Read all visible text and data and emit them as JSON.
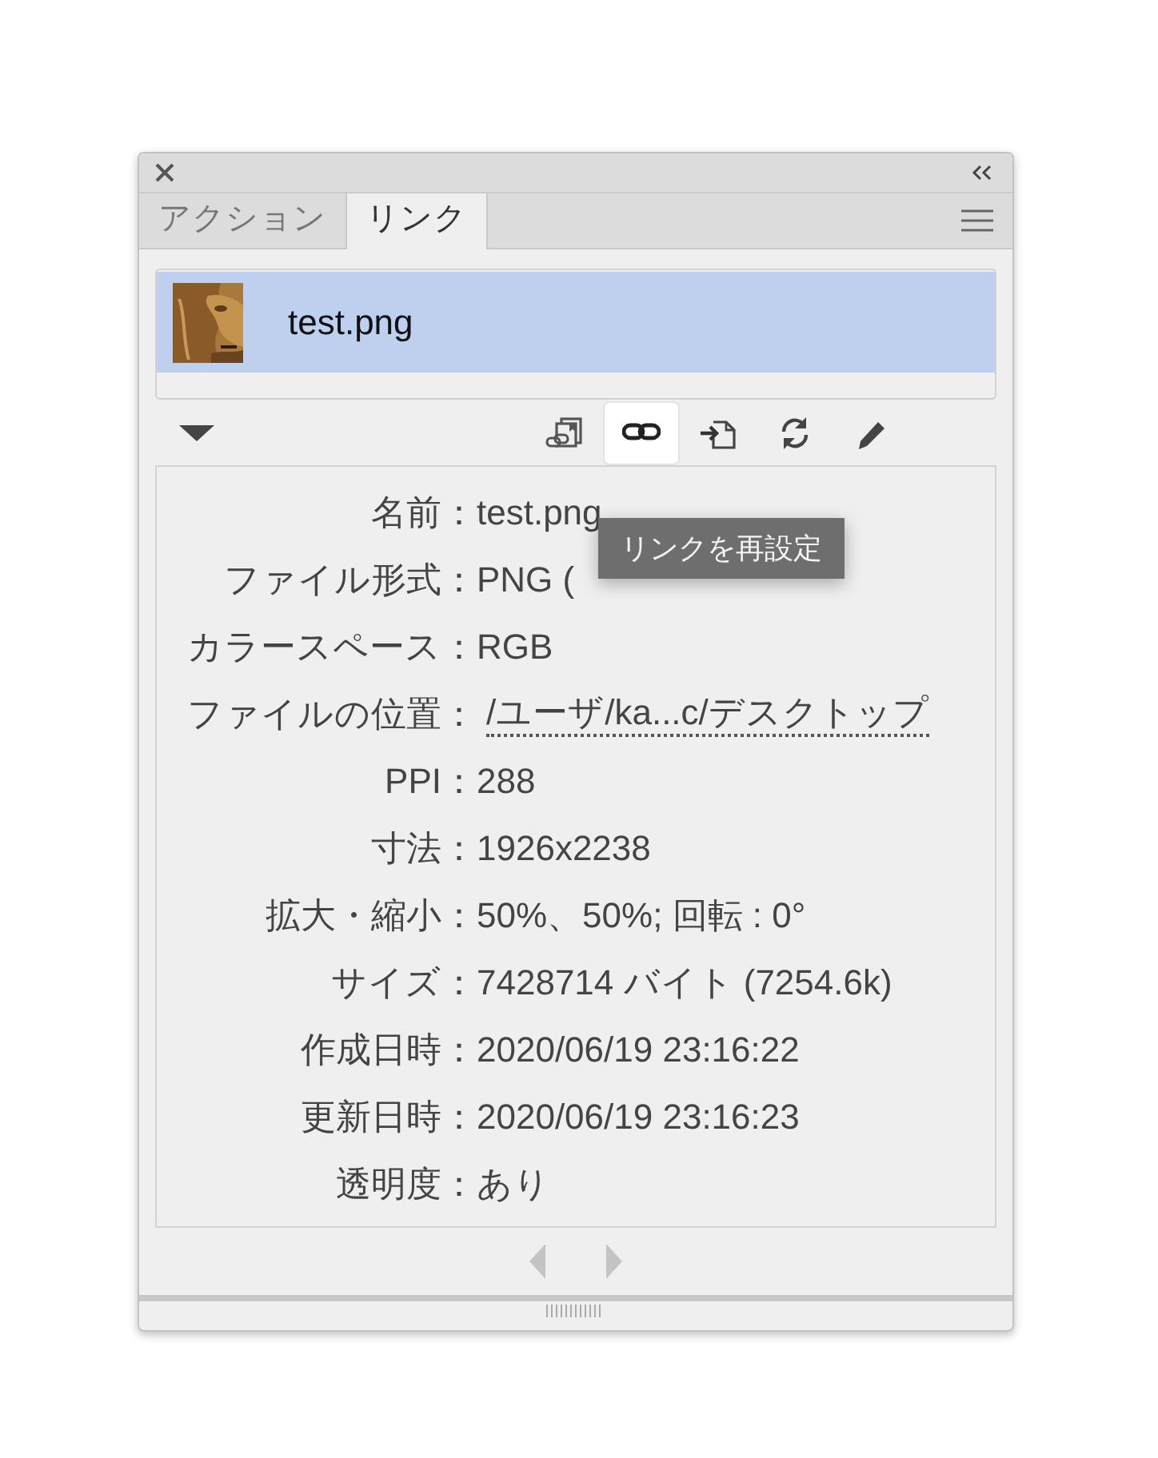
{
  "tabs": [
    {
      "label": "アクション",
      "selected": false
    },
    {
      "label": "リンク",
      "selected": true
    }
  ],
  "links": [
    {
      "name": "test.png",
      "selected": true
    }
  ],
  "toolbar": [
    {
      "kind": "relink-library",
      "selected": false
    },
    {
      "kind": "relink",
      "selected": true
    },
    {
      "kind": "place",
      "selected": false
    },
    {
      "kind": "update",
      "selected": false
    },
    {
      "kind": "edit",
      "selected": false
    }
  ],
  "tooltip": {
    "text": "リンクを再設定"
  },
  "info": [
    {
      "label": "名前：",
      "value": "test.png",
      "kind": "plain"
    },
    {
      "label": "ファイル形式：",
      "value": "PNG (",
      "kind": "plain"
    },
    {
      "label": "カラースペース：",
      "value": "RGB",
      "kind": "plain"
    },
    {
      "label": "ファイルの位置：",
      "value": "/ユーザ/ka...c/デスクトップ",
      "kind": "path"
    },
    {
      "label": "PPI：",
      "value": "288",
      "kind": "plain"
    },
    {
      "label": "寸法：",
      "value": "1926x2238",
      "kind": "plain"
    },
    {
      "label": "拡大・縮小：",
      "value": "50%、50%; 回転 : 0°",
      "kind": "plain"
    },
    {
      "label": "サイズ：",
      "value": "7428714 バイト (7254.6k)",
      "kind": "plain"
    },
    {
      "label": "作成日時：",
      "value": "2020/06/19 23:16:22",
      "kind": "plain"
    },
    {
      "label": "更新日時：",
      "value": "2020/06/19 23:16:23",
      "kind": "plain"
    },
    {
      "label": "透明度：",
      "value": "あり",
      "kind": "plain"
    }
  ]
}
